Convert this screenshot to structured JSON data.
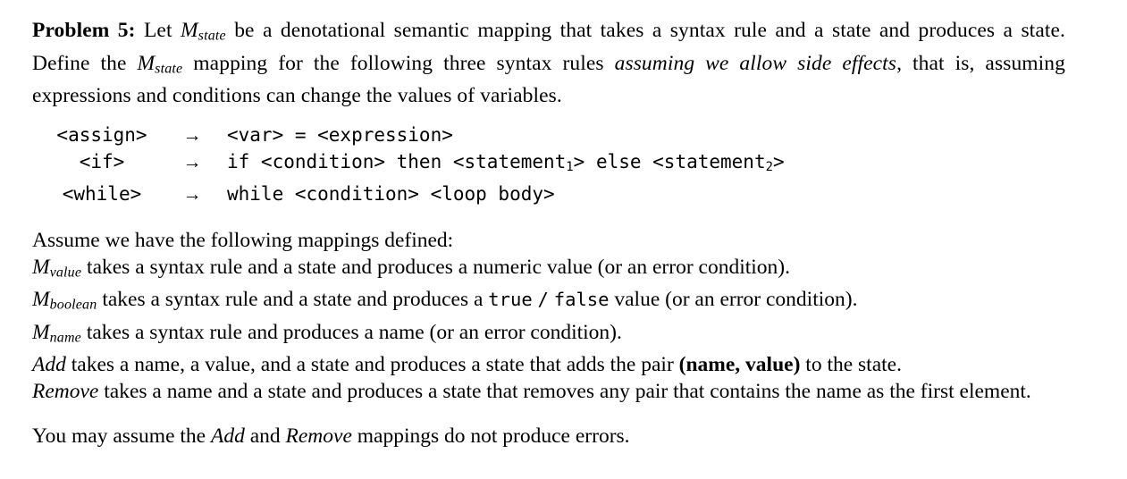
{
  "document": {
    "problem_label": "Problem 5:",
    "intro": {
      "part1": " Let ",
      "m_state_base": "M",
      "m_state_sub": "state",
      "part2": " be a denotational semantic mapping that takes a syntax rule and a state and produces a state.  Define the ",
      "part3": " mapping for the following three syntax rules ",
      "emphasis": "assuming we allow side effects",
      "part4": ", that is, assuming expressions and conditions can change the values of variables."
    },
    "rules_header": "",
    "rules": [
      {
        "lhs": "<assign>",
        "arrow": "→",
        "rhs_pre": "<var> = <expression>",
        "rhs_parts": [
          {
            "text": "<var> = <expression>",
            "sub": ""
          }
        ]
      },
      {
        "lhs": "<if>",
        "arrow": "→",
        "rhs_parts": [
          {
            "text": "if <condition> then <statement",
            "sub": "1"
          },
          {
            "text": "> else <statement",
            "sub": "2"
          },
          {
            "text": ">",
            "sub": ""
          }
        ]
      },
      {
        "lhs": "<while>",
        "arrow": "→",
        "rhs_parts": [
          {
            "text": "while <condition> <loop body>",
            "sub": ""
          }
        ]
      }
    ],
    "mappings_intro": "Assume we have the following mappings defined:",
    "mappings": [
      {
        "name_base": "M",
        "name_sub": "value",
        "text": " takes a syntax rule and a state and produces a numeric value (or an error condition)."
      },
      {
        "name_base": "M",
        "name_sub": "boolean",
        "text_before": " takes a syntax rule and a state and produces a ",
        "mono_true": "true",
        "mono_slash": "/",
        "mono_false": "false",
        "text_after": " value (or an error condition)."
      },
      {
        "name_base": "M",
        "name_sub": "name",
        "text": " takes a syntax rule and produces a name (or an error condition)."
      }
    ],
    "add_line": {
      "name": "Add",
      "text_before": " takes a name, a value, and a state and produces a state that adds the pair ",
      "bold_pair": "(name, value)",
      "text_after": " to the state."
    },
    "remove_line": {
      "name": "Remove",
      "text": " takes a name and a state and produces a state that removes any pair that contains the name as the first element."
    },
    "closing": {
      "part1": "You may assume the ",
      "name1": "Add",
      "part2": " and ",
      "name2": "Remove",
      "part3": " mappings do not produce errors."
    }
  },
  "colors": {
    "background": "#ffffff",
    "text": "#000000"
  }
}
